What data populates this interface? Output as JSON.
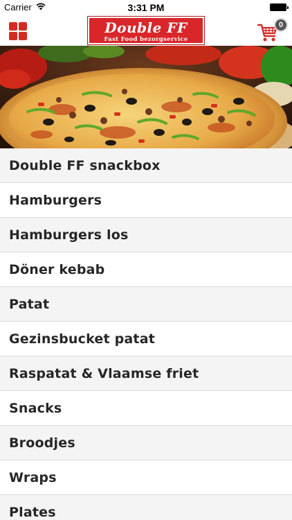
{
  "status_bar": {
    "carrier": "Carrier",
    "time": "3:31 PM"
  },
  "nav": {
    "logo_title": "Double FF",
    "logo_subtitle": "Fast Food bezorgservice",
    "cart_count": "0",
    "accent_color": "#d42a24"
  },
  "hero": {
    "image": "pizza-photo"
  },
  "menu": {
    "items": [
      {
        "label": "Double FF snackbox"
      },
      {
        "label": "Hamburgers"
      },
      {
        "label": "Hamburgers los"
      },
      {
        "label": "Döner kebab"
      },
      {
        "label": "Patat"
      },
      {
        "label": "Gezinsbucket patat"
      },
      {
        "label": "Raspatat & Vlaamse friet"
      },
      {
        "label": "Snacks"
      },
      {
        "label": "Broodjes"
      },
      {
        "label": "Wraps"
      },
      {
        "label": "Plates"
      }
    ]
  }
}
